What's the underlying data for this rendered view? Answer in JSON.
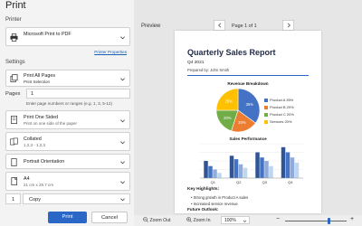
{
  "window": {
    "title": "Print"
  },
  "printer": {
    "section_label": "Printer",
    "name": "Microsoft Print to PDF",
    "properties_link": "Printer Properties"
  },
  "settings": {
    "section_label": "Settings",
    "print_range": {
      "label": "Print All Pages",
      "sub": "Print Selection"
    },
    "pages": {
      "label": "Pages",
      "value": "1",
      "hint": "Enter page numbers or ranges (e.g. 1, 3, 5-12)"
    },
    "sides": {
      "label": "Print One Sided",
      "sub": "Print on one side of the paper"
    },
    "collation": {
      "label": "Collated",
      "sub": "1,2,3 - 1,2,3"
    },
    "orientation": {
      "label": "Portrait Orientation"
    },
    "paper": {
      "label": "A4",
      "sub": "21 cm x 29.7 cm"
    },
    "copies": {
      "count": "1",
      "label": "Copy"
    }
  },
  "actions": {
    "print": "Print",
    "cancel": "Cancel"
  },
  "preview": {
    "label": "Preview",
    "prev_icon": "chevron-left-icon",
    "next_icon": "chevron-right-icon",
    "page_text": "Page 1 of 1"
  },
  "document": {
    "title": "Quarterly Sales Report",
    "period": "Q4 2021",
    "prepared_by": "Prepared by: John Smith",
    "key_highlights_label": "Key Highlights:",
    "highlights": [
      "Strong growth in Product A sales",
      "Increased service revenue"
    ],
    "future_outlook_label": "Future Outlook:"
  },
  "chart_data": [
    {
      "type": "pie",
      "title": "Revenue Breakdown",
      "categories": [
        "Product A",
        "Product B",
        "Product C",
        "Services"
      ],
      "values": [
        35,
        20,
        20,
        25
      ],
      "value_labels": [
        "35%",
        "20%",
        "20%",
        "25%"
      ],
      "legend_labels": [
        "Product A  35%",
        "Product B  20%",
        "Product C  20%",
        "Services  20%"
      ],
      "colors": [
        "#4472c4",
        "#ed7d31",
        "#70ad47",
        "#ffc000"
      ],
      "legend": "right"
    },
    {
      "type": "bar",
      "title": "Sales Performance",
      "categories": [
        "Q1",
        "Q2",
        "Q3",
        "Q4"
      ],
      "series": [
        {
          "values": [
            20,
            26,
            30,
            36
          ],
          "color": "#2f5597"
        },
        {
          "values": [
            14,
            22,
            24,
            30
          ],
          "color": "#4472c4"
        },
        {
          "values": [
            10,
            16,
            20,
            24
          ],
          "color": "#8faadc"
        },
        {
          "values": [
            6,
            12,
            14,
            18
          ],
          "color": "#bdd7ee"
        }
      ],
      "ylim": [
        0,
        40
      ],
      "grid": true
    }
  ],
  "zoom": {
    "zoom_out_label": "Zoom Out",
    "zoom_in_label": "Zoom In",
    "level": "100%",
    "slider_level": 0.72
  },
  "colors": {
    "accent": "#2a67c7",
    "doc_title": "#1f2a44"
  }
}
